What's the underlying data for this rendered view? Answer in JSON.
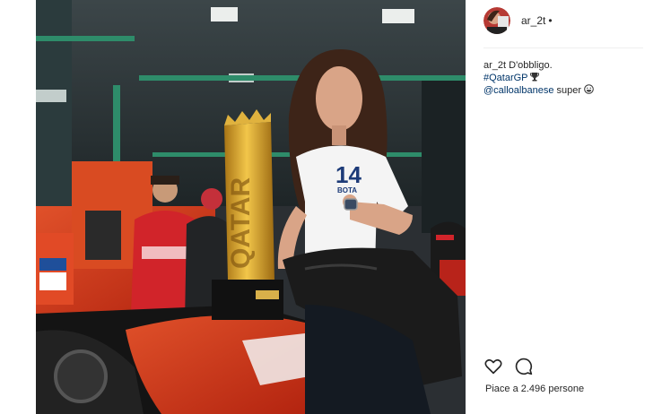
{
  "post": {
    "username": "ar_2t",
    "follow_dot": "•",
    "caption": {
      "author": "ar_2t",
      "text": "D'obbligo.",
      "hashtag": "#QatarGP",
      "trophy_icon": "trophy-icon",
      "mention": "@calloalbanese",
      "mention_suffix": "super",
      "face_icon": "grinning-face-icon"
    },
    "likes_text": "Piace a 2.496 persone"
  },
  "photo": {
    "jersey_number": "14",
    "jersey_text": "BOTA",
    "trophy_text": "QATAR"
  },
  "icons": {
    "like": "heart-icon",
    "comment": "comment-icon"
  },
  "colors": {
    "link": "#003569",
    "text": "#262626",
    "divider": "#efefef",
    "ducati_red": "#c8281f"
  }
}
